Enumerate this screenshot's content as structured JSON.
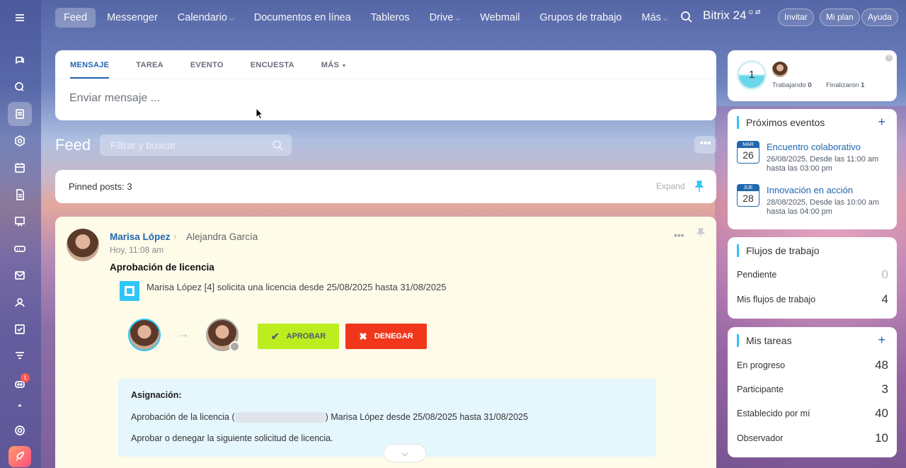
{
  "topbar": {
    "nav": [
      {
        "label": "Feed",
        "active": true,
        "dropdown": false
      },
      {
        "label": "Messenger",
        "dropdown": false
      },
      {
        "label": "Calendario",
        "dropdown": true
      },
      {
        "label": "Documentos en línea",
        "dropdown": false
      },
      {
        "label": "Tableros",
        "dropdown": false
      },
      {
        "label": "Drive",
        "dropdown": true
      },
      {
        "label": "Webmail",
        "dropdown": false
      },
      {
        "label": "Grupos de trabajo",
        "dropdown": false
      },
      {
        "label": "Más",
        "dropdown": true
      }
    ],
    "brand": "Bitrix 24",
    "invite": "Invitar",
    "plan": "Mi plan",
    "help": "Ayuda"
  },
  "sidebar": {
    "notification_count": "1"
  },
  "composer": {
    "tabs": [
      "MENSAJE",
      "TAREA",
      "EVENTO",
      "ENCUESTA",
      "MÁS"
    ],
    "placeholder": "Enviar mensaje ..."
  },
  "feed": {
    "title": "Feed",
    "filter_placeholder": "Filtrar y buscar",
    "pinned_label": "Pinned posts:",
    "pinned_count": "3",
    "expand_label": "Expand"
  },
  "post": {
    "author": "Marisa López",
    "recipient": "Alejandra García",
    "time": "Hoy, 11:08 am",
    "title": "Aprobación de licencia",
    "request_text": "Marisa López [4] solicita una licencia desde 25/08/2025 hasta 31/08/2025",
    "approve_label": "APROBAR",
    "deny_label": "DENEGAR",
    "assignment_heading": "Asignación:",
    "assignment_line_prefix": "Aprobación de la licencia (",
    "assignment_line_suffix": ") Marisa López desde 25/08/2025 hasta 31/08/2025",
    "assignment_instruction": "Aprobar o denegar la siguiente solicitud de licencia."
  },
  "worktime": {
    "count": "1",
    "working_label": "Trabajando",
    "working_count": "0",
    "finished_label": "Finalizaron",
    "finished_count": "1"
  },
  "events": {
    "heading": "Próximos eventos",
    "items": [
      {
        "month": "MAR",
        "day": "26",
        "title": "Encuentro colaborativo",
        "line1": "26/08/2025, Desde las 11:00 am",
        "line2": "hasta las 03:00 pm"
      },
      {
        "month": "JUE",
        "day": "28",
        "title": "Innovación en acción",
        "line1": "28/08/2025, Desde las 10:00 am",
        "line2": "hasta las 04:00 pm"
      }
    ]
  },
  "workflows": {
    "heading": "Flujos de trabajo",
    "rows": [
      {
        "label": "Pendiente",
        "value": "0"
      },
      {
        "label": "Mis flujos de trabajo",
        "value": "4"
      }
    ]
  },
  "tasks": {
    "heading": "Mis tareas",
    "rows": [
      {
        "label": "En progreso",
        "value": "48"
      },
      {
        "label": "Participante",
        "value": "3"
      },
      {
        "label": "Establecido por mí",
        "value": "40"
      },
      {
        "label": "Observador",
        "value": "10"
      }
    ]
  },
  "colors": {
    "accent": "#2067b0",
    "approve": "#bbed21",
    "deny": "#f0371b",
    "cyan": "#2fc6f6"
  }
}
